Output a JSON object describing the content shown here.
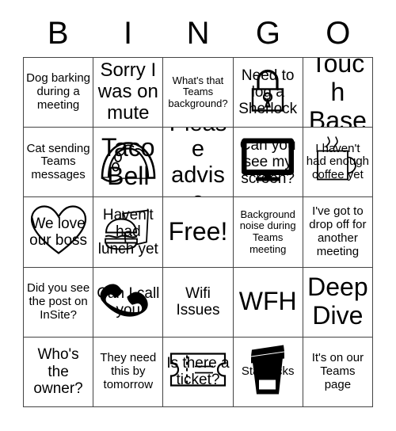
{
  "header": {
    "letters": [
      "B",
      "I",
      "N",
      "G",
      "O"
    ]
  },
  "grid": {
    "rows": 5,
    "columns": 5,
    "border_color": "#444444",
    "background_color": "#ffffff",
    "text_color": "#000000",
    "cells": [
      {
        "text": "Dog barking during a meeting",
        "icon": "none",
        "size": "sm"
      },
      {
        "text": "Sorry I was on mute",
        "icon": "none",
        "size": "lg"
      },
      {
        "text": "What's that Teams background?",
        "icon": "none",
        "size": "xs"
      },
      {
        "text": "Need to log a Sherlock",
        "icon": "padlock-icon",
        "size": "md"
      },
      {
        "text": "Touch Base",
        "icon": "none",
        "size": "xxl"
      },
      {
        "text": "Cat sending Teams messages",
        "icon": "none",
        "size": "sm"
      },
      {
        "text": "Taco Bell",
        "icon": "taco-icon",
        "size": "xxl"
      },
      {
        "text": "Please advise",
        "icon": "none",
        "size": "xl"
      },
      {
        "text": "Can you see my screen?",
        "icon": "monitor-icon",
        "size": "md"
      },
      {
        "text": "I haven't had enough coffee yet",
        "icon": "coffee-mug-icon",
        "size": "sm"
      },
      {
        "text": "We love our boss",
        "icon": "heart-icon",
        "size": "md"
      },
      {
        "text": "Haven't had lunch yet",
        "icon": "burger-icon",
        "size": "md"
      },
      {
        "text": "Free!",
        "icon": "none",
        "size": "xxl"
      },
      {
        "text": "Background noise during Teams meeting",
        "icon": "none",
        "size": "xs"
      },
      {
        "text": "I've got to drop off for another meeting",
        "icon": "none",
        "size": "sm"
      },
      {
        "text": "Did you see the post on InSite?",
        "icon": "none",
        "size": "sm"
      },
      {
        "text": "Can I call you",
        "icon": "telephone-icon",
        "size": "md"
      },
      {
        "text": "Wifi Issues",
        "icon": "none",
        "size": "md"
      },
      {
        "text": "WFH",
        "icon": "none",
        "size": "xxl"
      },
      {
        "text": "Deep Dive",
        "icon": "none",
        "size": "xxl"
      },
      {
        "text": "Who's the owner?",
        "icon": "none",
        "size": "md"
      },
      {
        "text": "They need this by tomorrow",
        "icon": "none",
        "size": "sm"
      },
      {
        "text": "Is there a ticket?",
        "icon": "ticket-icon",
        "size": "md"
      },
      {
        "text": "Starbucks",
        "icon": "togo-cup-icon",
        "size": "sm"
      },
      {
        "text": "It's on our Teams page",
        "icon": "none",
        "size": "sm"
      }
    ]
  }
}
